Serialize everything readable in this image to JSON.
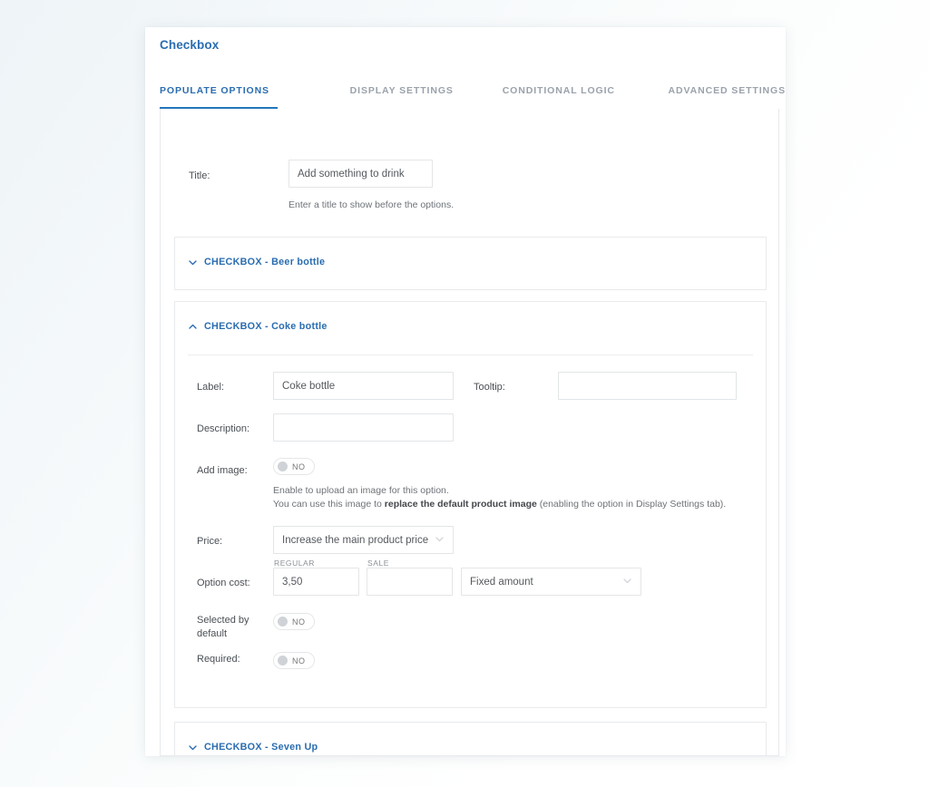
{
  "card": {
    "title": "Checkbox"
  },
  "tabs": [
    {
      "label": "POPULATE OPTIONS",
      "active": true
    },
    {
      "label": "DISPLAY SETTINGS",
      "active": false
    },
    {
      "label": "CONDITIONAL LOGIC",
      "active": false
    },
    {
      "label": "ADVANCED SETTINGS",
      "active": false
    }
  ],
  "title_field": {
    "label": "Title:",
    "value": "Add something to drink",
    "hint": "Enter a title to show before the options."
  },
  "accordions": [
    {
      "title": "CHECKBOX - Beer bottle",
      "expanded": false,
      "icon": "chevron-down-icon"
    },
    {
      "title": "CHECKBOX - Coke bottle",
      "expanded": true,
      "icon": "chevron-up-icon"
    },
    {
      "title": "CHECKBOX - Seven Up",
      "expanded": false,
      "icon": "chevron-down-icon"
    }
  ],
  "option_form": {
    "label": {
      "label": "Label:",
      "value": "Coke bottle"
    },
    "tooltip": {
      "label": "Tooltip:",
      "value": ""
    },
    "description": {
      "label": "Description:",
      "value": ""
    },
    "add_image": {
      "label": "Add image:",
      "toggle_value": "NO",
      "hint_line_1": "Enable to upload an image for this option.",
      "hint_line_2_pre": "You can use this image to ",
      "hint_line_2_bold": "replace the default product image",
      "hint_line_2_post": " (enabling the option in Display Settings tab)."
    },
    "price": {
      "label": "Price:",
      "selected": "Increase the main product price"
    },
    "option_cost": {
      "label": "Option cost:",
      "regular_micro": "REGULAR",
      "sale_micro": "SALE",
      "regular_value": "3,50",
      "sale_value": "",
      "amount_type_selected": "Fixed amount"
    },
    "selected_by_default": {
      "label": "Selected by default",
      "toggle_value": "NO"
    },
    "required": {
      "label": "Required:",
      "toggle_value": "NO"
    }
  },
  "colors": {
    "accent_blue": "#2a6db0",
    "tab_underline": "#2277bb",
    "muted_text": "#9aa2ab",
    "border": "#e8eaec"
  }
}
